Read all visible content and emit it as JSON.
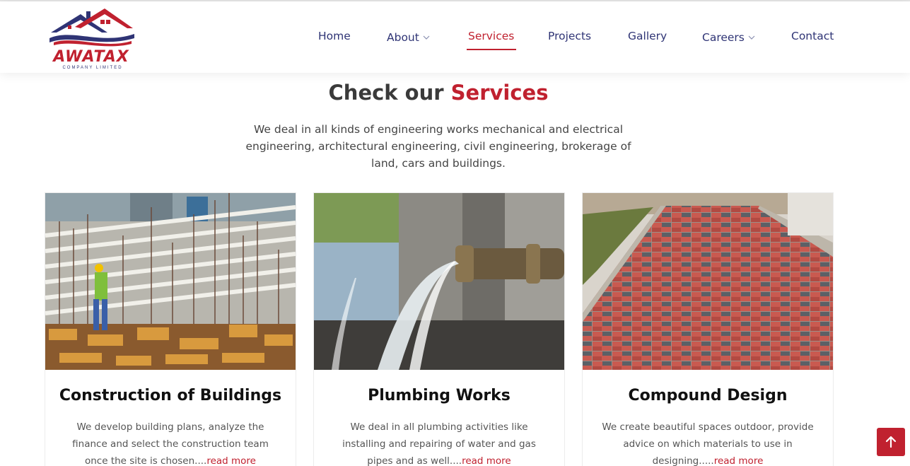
{
  "brand": {
    "name": "AWATAX",
    "tagline": "COMPANY LIMITED",
    "colors": {
      "primary": "#c0212f",
      "navy": "#2f3475"
    }
  },
  "nav": {
    "items": [
      {
        "label": "Home",
        "has_dropdown": false,
        "active": false
      },
      {
        "label": "About",
        "has_dropdown": true,
        "active": false
      },
      {
        "label": "Services",
        "has_dropdown": false,
        "active": true
      },
      {
        "label": "Projects",
        "has_dropdown": false,
        "active": false
      },
      {
        "label": "Gallery",
        "has_dropdown": false,
        "active": false
      },
      {
        "label": "Careers",
        "has_dropdown": true,
        "active": false
      },
      {
        "label": "Contact",
        "has_dropdown": false,
        "active": false
      }
    ]
  },
  "section": {
    "title_prefix": "Check our ",
    "title_accent": "Services",
    "intro": "We deal in all kinds of engineering works mechanical and electrical engineering, architectural engineering, civil engineering, brokerage of land, cars and buildings."
  },
  "cards": [
    {
      "title": "Construction of Buildings",
      "text": "We develop building plans, analyze the finance and select the construction team once the site is chosen....",
      "link": "read more",
      "image": "construction-site-photo"
    },
    {
      "title": "Plumbing Works",
      "text": "We deal in all plumbing activities like installing and repairing of water and gas pipes and as well....",
      "link": "read more",
      "image": "water-pipe-photo"
    },
    {
      "title": "Compound Design",
      "text": "We create beautiful spaces outdoor, provide advice on which materials to use in designing.....",
      "link": "read more",
      "image": "paved-walkway-photo"
    }
  ],
  "back_to_top": {
    "icon": "arrow-up-icon"
  }
}
